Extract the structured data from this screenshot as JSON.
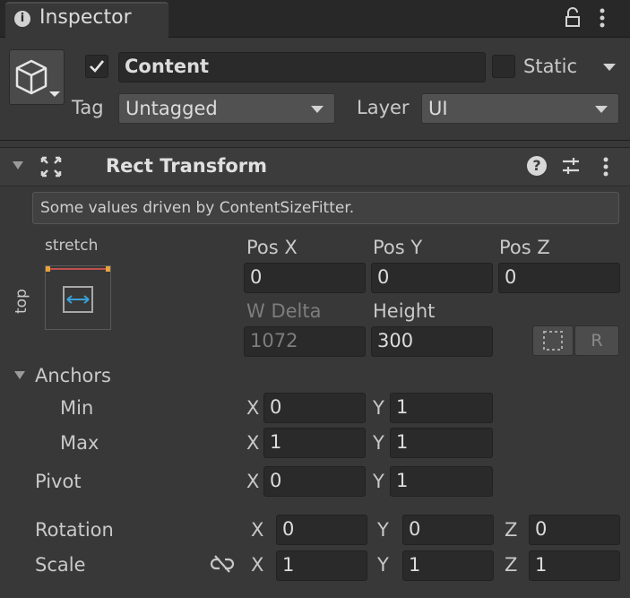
{
  "tab": {
    "title": "Inspector"
  },
  "object": {
    "active_checked": true,
    "name": "Content",
    "static_label": "Static",
    "tag_label": "Tag",
    "tag_value": "Untagged",
    "layer_label": "Layer",
    "layer_value": "UI"
  },
  "component": {
    "title": "Rect Transform",
    "help_message": "Some values driven by ContentSizeFitter.",
    "anchor_preset": {
      "horizontal": "stretch",
      "vertical": "top"
    },
    "labels": {
      "pos_x": "Pos X",
      "pos_y": "Pos Y",
      "pos_z": "Pos Z",
      "w_delta": "W Delta",
      "height": "Height",
      "anchors": "Anchors",
      "min": "Min",
      "max": "Max",
      "pivot": "Pivot",
      "rotation": "Rotation",
      "scale": "Scale",
      "x": "X",
      "y": "Y",
      "z": "Z"
    },
    "values": {
      "pos_x": "0",
      "pos_y": "0",
      "pos_z": "0",
      "w_delta": "1072",
      "height": "300",
      "anchor_min_x": "0",
      "anchor_min_y": "1",
      "anchor_max_x": "1",
      "anchor_max_y": "1",
      "pivot_x": "0",
      "pivot_y": "1",
      "rotation_x": "0",
      "rotation_y": "0",
      "rotation_z": "0",
      "scale_x": "1",
      "scale_y": "1",
      "scale_z": "1"
    },
    "raw_edit_label": "R"
  },
  "colors": {
    "anchor_line": "#e8a33a",
    "anchor_arrow": "#3aa0d8",
    "anchor_red": "#c0504d"
  }
}
